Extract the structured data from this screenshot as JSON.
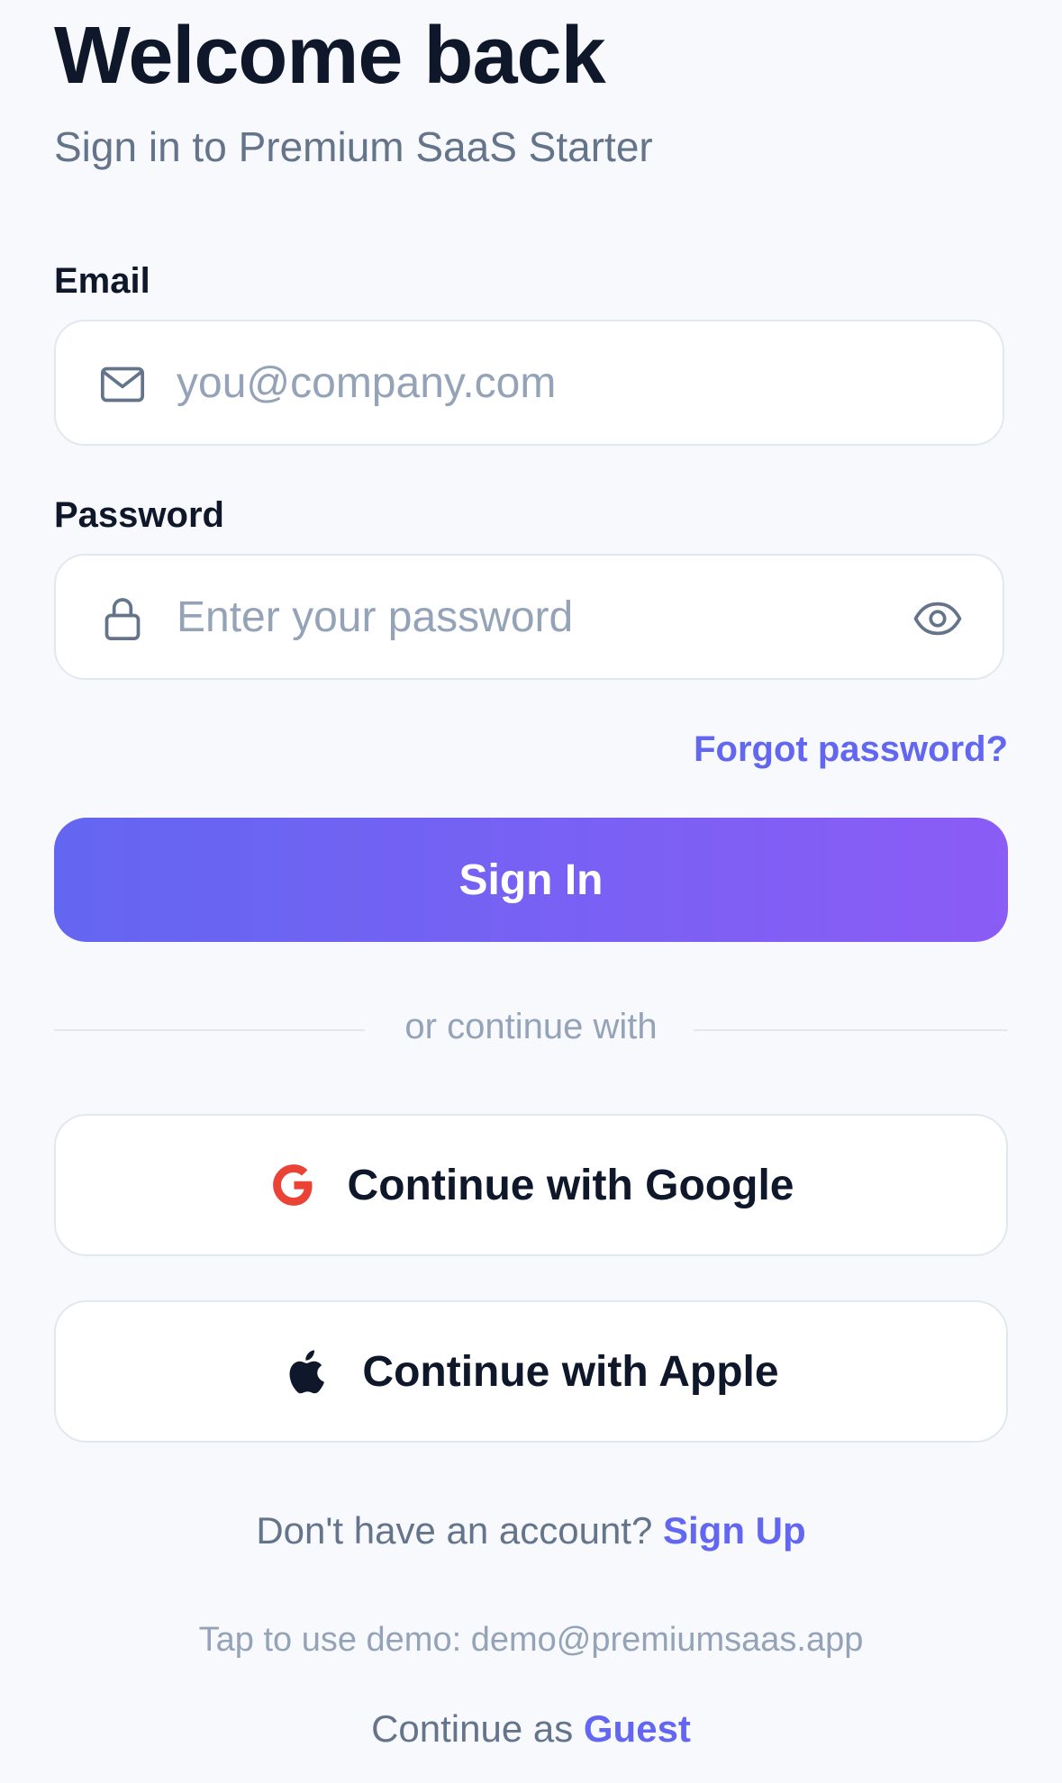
{
  "header": {
    "title": "Welcome back",
    "subtitle": "Sign in to Premium SaaS Starter"
  },
  "email": {
    "label": "Email",
    "value": "",
    "placeholder": "you@company.com",
    "icon": "mail-icon"
  },
  "password": {
    "label": "Password",
    "value": "",
    "placeholder": "Enter your password",
    "icon": "lock-icon",
    "toggle_icon": "eye-icon"
  },
  "forgot_label": "Forgot password?",
  "sign_in_label": "Sign In",
  "divider_label": "or continue with",
  "social": {
    "google_label": "Continue with Google",
    "google_icon": "google-icon",
    "apple_label": "Continue with Apple",
    "apple_icon": "apple-icon"
  },
  "footer": {
    "signup_prompt": "Don't have an account?",
    "signup_link": "Sign Up",
    "demo_text": "Tap to use demo: demo@premiumsaas.app",
    "guest_prompt": "Continue as",
    "guest_link": "Guest"
  },
  "colors": {
    "background": "#f7f9fc",
    "accent": "#6366f1",
    "gradient_start": "#6366f1",
    "gradient_end": "#8b5cf6",
    "text_primary": "#0f172a",
    "text_muted": "#64748b",
    "placeholder": "#94a3b8",
    "google_red": "#ea4335"
  }
}
